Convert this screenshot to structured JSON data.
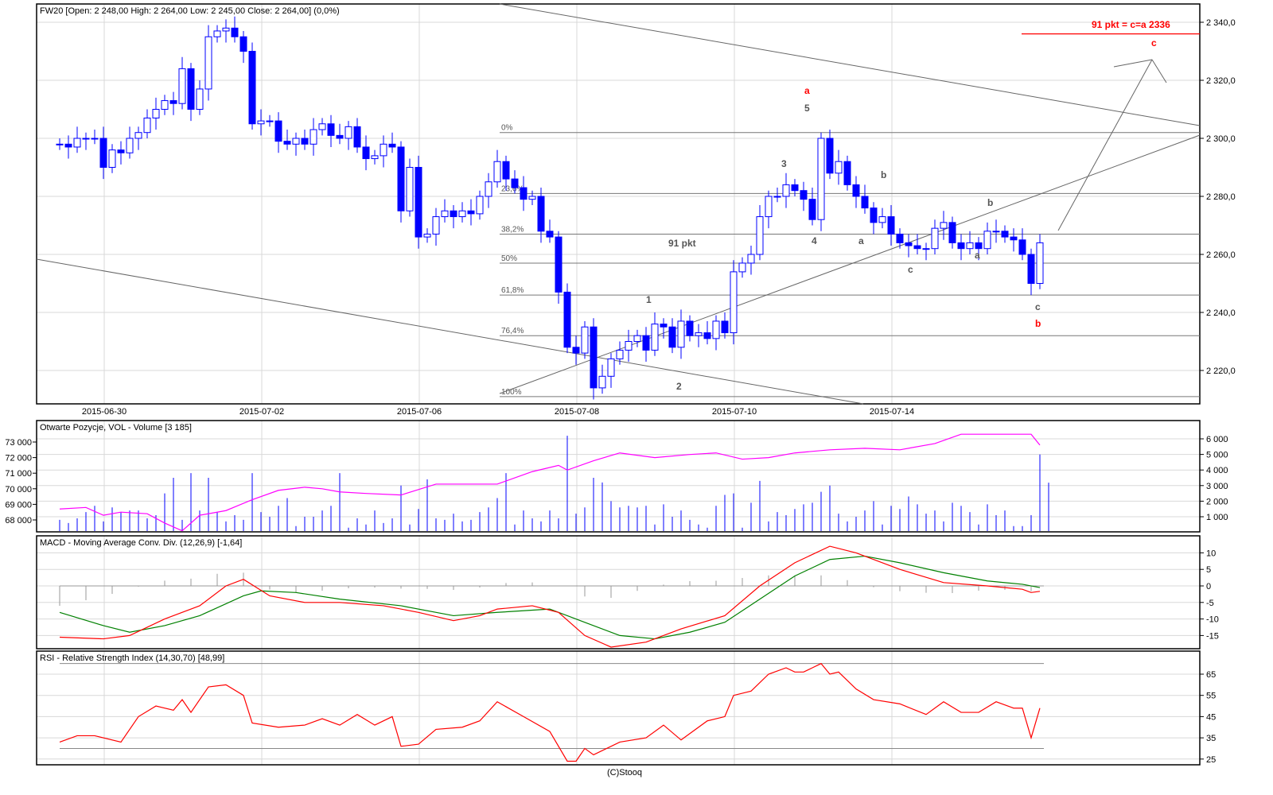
{
  "chart_data": [
    {
      "type": "candlestick",
      "title": "FW20 [Open: 2 248,00  High: 2 264,00  Low: 2 245,00  Close: 2 264,00] (0,0%)",
      "ylim": [
        2210,
        2346
      ],
      "yticks": [
        2220,
        2240,
        2260,
        2280,
        2300,
        2320,
        2340
      ],
      "ytick_labels": [
        "2 220,0",
        "2 240,0",
        "2 260,0",
        "2 280,0",
        "2 300,0",
        "2 320,0",
        "2 340,0"
      ],
      "xtick_labels": [
        {
          "i": 5,
          "label": "2015-06-30"
        },
        {
          "i": 23,
          "label": "2015-07-02"
        },
        {
          "i": 41,
          "label": "2015-07-06"
        },
        {
          "i": 59,
          "label": "2015-07-08"
        },
        {
          "i": 77,
          "label": "2015-07-10"
        },
        {
          "i": 95,
          "label": "2015-07-14"
        }
      ],
      "first_open": 2298,
      "closes": [
        2298,
        2297,
        2300,
        2300,
        2300,
        2290,
        2296,
        2295,
        2300,
        2302,
        2307,
        2310,
        2313,
        2312,
        2324,
        2310,
        2317,
        2335,
        2337,
        2338,
        2335,
        2330,
        2305,
        2306,
        2306,
        2299,
        2298,
        2300,
        2298,
        2303,
        2305,
        2301,
        2300,
        2304,
        2297,
        2293,
        2294,
        2298,
        2297,
        2275,
        2290,
        2266,
        2267,
        2273,
        2275,
        2273,
        2275,
        2274,
        2280,
        2285,
        2292,
        2286,
        2283,
        2279,
        2280,
        2268,
        2266,
        2247,
        2228,
        2226,
        2235,
        2214,
        2218,
        2224,
        2227,
        2230,
        2232,
        2227,
        2236,
        2235,
        2228,
        2237,
        2232,
        2233,
        2231,
        2237,
        2233,
        2254,
        2257,
        2260,
        2273,
        2280,
        2280,
        2284,
        2282,
        2279,
        2272,
        2300,
        2288,
        2292,
        2284,
        2280,
        2276,
        2271,
        2273,
        2267,
        2264,
        2263,
        2262,
        2262,
        2269,
        2271,
        2264,
        2262,
        2264,
        2262,
        2268,
        2268,
        2266,
        2265,
        2260,
        2250,
        2264
      ],
      "fibonacci": [
        {
          "label": "0%",
          "value": 2302
        },
        {
          "label": "23,6%",
          "value": 2281
        },
        {
          "label": "38,2%",
          "value": 2267
        },
        {
          "label": "50%",
          "value": 2257
        },
        {
          "label": "61,8%",
          "value": 2246
        },
        {
          "label": "76,4%",
          "value": 2232
        },
        {
          "label": "100%",
          "value": 2211
        }
      ],
      "annotations": {
        "target": "91 pkt =  c=a 2336",
        "target_value": 2336,
        "pkt": "91 pkt",
        "waves_red": [
          "a",
          "b",
          "c"
        ],
        "waves_gray": [
          "1",
          "2",
          "3",
          "4",
          "5",
          "a",
          "b",
          "c",
          "a",
          "b",
          "c"
        ]
      }
    },
    {
      "type": "bar+line",
      "title": "Otwarte Pozycje, VOL - Volume [3 185]",
      "volume_yticks": [
        1000,
        2000,
        3000,
        4000,
        5000,
        6000
      ],
      "volume_labels": [
        "1 000",
        "2 000",
        "3 000",
        "4 000",
        "5 000",
        "6 000"
      ],
      "oi_yticks": [
        68000,
        69000,
        70000,
        71000,
        72000,
        73000
      ],
      "oi_labels": [
        "68 000",
        "69 000",
        "70 000",
        "71 000",
        "72 000",
        "73 000"
      ],
      "volume": [
        800,
        600,
        900,
        1300,
        1700,
        700,
        1600,
        1300,
        1400,
        1400,
        900,
        1100,
        2500,
        3500,
        800,
        3800,
        1400,
        3500,
        1300,
        700,
        1100,
        800,
        3800,
        1300,
        1000,
        1700,
        2200,
        400,
        1000,
        1000,
        1400,
        1700,
        3800,
        300,
        900,
        500,
        1400,
        600,
        900,
        3000,
        500,
        1500,
        3400,
        900,
        800,
        1200,
        700,
        800,
        1300,
        1600,
        2200,
        3800,
        500,
        1400,
        900,
        700,
        1400,
        900,
        6200,
        1200,
        1600,
        3500,
        3200,
        2000,
        1600,
        1700,
        1600,
        1700,
        500,
        1800,
        1000,
        1400,
        800,
        500,
        300,
        1700,
        2400,
        2500,
        300,
        1900,
        3300,
        700,
        1300,
        1100,
        1500,
        1800,
        1900,
        2600,
        3000,
        1200,
        700,
        1000,
        1400,
        2000,
        500,
        1700,
        1500,
        2300,
        1800,
        1200,
        1400,
        700,
        1900,
        1700,
        1300,
        500,
        1800,
        1100,
        1400,
        400,
        400,
        1100,
        5000,
        3185
      ],
      "open_interest": [
        [
          0,
          68700
        ],
        [
          3,
          68800
        ],
        [
          5,
          68300
        ],
        [
          7,
          68500
        ],
        [
          10,
          68400
        ],
        [
          12,
          67800
        ],
        [
          14,
          67300
        ],
        [
          16,
          68300
        ],
        [
          19,
          68600
        ],
        [
          22,
          69300
        ],
        [
          25,
          69900
        ],
        [
          28,
          70100
        ],
        [
          30,
          70000
        ],
        [
          32,
          69800
        ],
        [
          35,
          69700
        ],
        [
          39,
          69600
        ],
        [
          43,
          70300
        ],
        [
          48,
          70300
        ],
        [
          50,
          70300
        ],
        [
          54,
          71100
        ],
        [
          57,
          71500
        ],
        [
          58,
          71200
        ],
        [
          61,
          71800
        ],
        [
          64,
          72300
        ],
        [
          68,
          72000
        ],
        [
          72,
          72200
        ],
        [
          75,
          72300
        ],
        [
          78,
          71900
        ],
        [
          81,
          72000
        ],
        [
          84,
          72300
        ],
        [
          88,
          72500
        ],
        [
          92,
          72600
        ],
        [
          96,
          72500
        ],
        [
          100,
          72900
        ],
        [
          103,
          73500
        ],
        [
          106,
          73500
        ],
        [
          111,
          73500
        ],
        [
          112,
          72800
        ]
      ]
    },
    {
      "type": "line",
      "title": "MACD - Moving Average Conv. Div. (12,26,9) [-1,64]",
      "yticks": [
        -15,
        -10,
        -5,
        0,
        5,
        10
      ],
      "ytick_labels": [
        "-15",
        "-10",
        "-5",
        "0",
        "5",
        "10"
      ],
      "macd": [
        [
          0,
          -15.5
        ],
        [
          5,
          -16
        ],
        [
          8,
          -15
        ],
        [
          12,
          -10
        ],
        [
          16,
          -6
        ],
        [
          19,
          0
        ],
        [
          21,
          2
        ],
        [
          24,
          -3
        ],
        [
          28,
          -5
        ],
        [
          32,
          -5
        ],
        [
          37,
          -6
        ],
        [
          41,
          -8
        ],
        [
          45,
          -10.5
        ],
        [
          48,
          -9
        ],
        [
          50,
          -7
        ],
        [
          54,
          -6
        ],
        [
          57,
          -8
        ],
        [
          60,
          -15
        ],
        [
          63,
          -18.5
        ],
        [
          67,
          -17
        ],
        [
          71,
          -13
        ],
        [
          76,
          -9
        ],
        [
          80,
          0
        ],
        [
          84,
          7
        ],
        [
          88,
          12
        ],
        [
          91,
          10
        ],
        [
          96,
          5
        ],
        [
          101,
          1
        ],
        [
          106,
          0
        ],
        [
          110,
          -1
        ],
        [
          111,
          -2
        ],
        [
          112,
          -1.64
        ]
      ],
      "signal": [
        [
          0,
          -8
        ],
        [
          5,
          -12
        ],
        [
          8,
          -14
        ],
        [
          12,
          -12
        ],
        [
          16,
          -9
        ],
        [
          21,
          -3
        ],
        [
          23,
          -1.5
        ],
        [
          27,
          -2
        ],
        [
          32,
          -4
        ],
        [
          39,
          -6
        ],
        [
          45,
          -9
        ],
        [
          50,
          -8
        ],
        [
          56,
          -7
        ],
        [
          60,
          -11
        ],
        [
          64,
          -15
        ],
        [
          68,
          -16
        ],
        [
          72,
          -14
        ],
        [
          76,
          -11
        ],
        [
          80,
          -4
        ],
        [
          84,
          3
        ],
        [
          88,
          8
        ],
        [
          92,
          9
        ],
        [
          96,
          7
        ],
        [
          101,
          4
        ],
        [
          106,
          1.5
        ],
        [
          110,
          0.5
        ],
        [
          112,
          -0.5
        ]
      ]
    },
    {
      "type": "line",
      "title": "RSI - Relative Strength Index (14,30,70) [48,99]",
      "yticks": [
        25,
        35,
        45,
        55,
        65
      ],
      "ytick_labels": [
        "25",
        "35",
        "45",
        "55",
        "65"
      ],
      "levels": [
        30,
        70
      ],
      "rsi": [
        [
          0,
          33
        ],
        [
          2,
          36
        ],
        [
          4,
          36
        ],
        [
          7,
          33
        ],
        [
          9,
          45
        ],
        [
          11,
          50
        ],
        [
          13,
          48
        ],
        [
          14,
          53
        ],
        [
          15,
          47
        ],
        [
          17,
          59
        ],
        [
          19,
          60
        ],
        [
          21,
          55
        ],
        [
          22,
          42
        ],
        [
          25,
          40
        ],
        [
          28,
          41
        ],
        [
          30,
          44
        ],
        [
          32,
          41
        ],
        [
          34,
          46
        ],
        [
          36,
          41
        ],
        [
          38,
          45
        ],
        [
          39,
          31
        ],
        [
          41,
          32
        ],
        [
          43,
          39
        ],
        [
          46,
          40
        ],
        [
          48,
          43
        ],
        [
          50,
          52
        ],
        [
          53,
          45
        ],
        [
          56,
          38
        ],
        [
          58,
          24
        ],
        [
          59,
          24
        ],
        [
          60,
          30
        ],
        [
          61,
          27
        ],
        [
          64,
          33
        ],
        [
          67,
          35
        ],
        [
          69,
          41
        ],
        [
          71,
          34
        ],
        [
          74,
          43
        ],
        [
          76,
          45
        ],
        [
          77,
          55
        ],
        [
          79,
          57
        ],
        [
          81,
          65
        ],
        [
          83,
          68
        ],
        [
          84,
          66
        ],
        [
          85,
          66
        ],
        [
          86,
          68
        ],
        [
          87,
          70
        ],
        [
          88,
          65
        ],
        [
          89,
          66
        ],
        [
          91,
          58
        ],
        [
          93,
          53
        ],
        [
          96,
          51
        ],
        [
          99,
          46
        ],
        [
          101,
          52
        ],
        [
          103,
          47
        ],
        [
          105,
          47
        ],
        [
          107,
          52
        ],
        [
          109,
          49
        ],
        [
          110,
          49
        ],
        [
          111,
          35
        ],
        [
          112,
          49
        ]
      ]
    }
  ],
  "footer": "(C)Stooq",
  "colors": {
    "up": "#ffffff",
    "down": "#0000ff",
    "oi": "#ff00ff",
    "macd": "#ff0000",
    "signal": "#008000",
    "hist": "#999999",
    "rsi": "#ff0000",
    "grid": "#d8d8d8",
    "annot": "#ff0000"
  }
}
